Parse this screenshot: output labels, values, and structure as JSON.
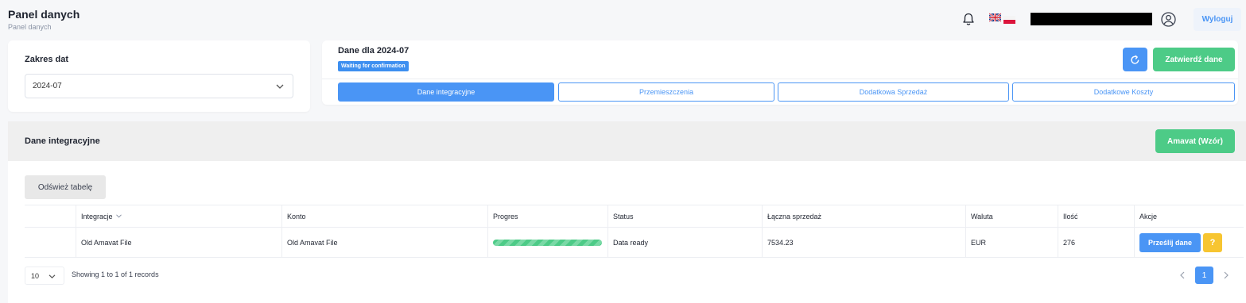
{
  "header": {
    "title": "Panel danych",
    "breadcrumb": "Panel danych",
    "logout_label": "Wyloguj"
  },
  "date_range": {
    "label": "Zakres dat",
    "selected": "2024-07"
  },
  "data_panel": {
    "title": "Dane dla 2024-07",
    "status_badge": "Waiting for confirmation",
    "confirm_label": "Zatwierdź dane",
    "tabs": [
      {
        "label": "Dane integracyjne",
        "active": true
      },
      {
        "label": "Przemieszczenia",
        "active": false
      },
      {
        "label": "Dodatkowa Sprzedaż",
        "active": false
      },
      {
        "label": "Dodatkowe Koszty",
        "active": false
      }
    ]
  },
  "integration_section": {
    "title": "Dane integracyjne",
    "template_button": "Amavat (Wzór)",
    "reload_button": "Odśwież tabelę",
    "columns": [
      "",
      "Integracje",
      "Konto",
      "Progres",
      "Status",
      "Łączna sprzedaż",
      "Waluta",
      "Ilość",
      "Akcje"
    ],
    "rows": [
      {
        "integration": "Old Amavat File",
        "account": "Old Amavat File",
        "progress": 1.0,
        "status": "Data ready",
        "total_sales": "7534.23",
        "currency": "EUR",
        "quantity": "276",
        "send_label": "Prześlij dane",
        "help_label": "?"
      }
    ],
    "page_size": "10",
    "showing": "Showing 1 to 1 of 1 records",
    "current_page": "1"
  },
  "colors": {
    "primary": "#4a95f5",
    "success": "#4dcb87",
    "warning": "#f7c531"
  }
}
